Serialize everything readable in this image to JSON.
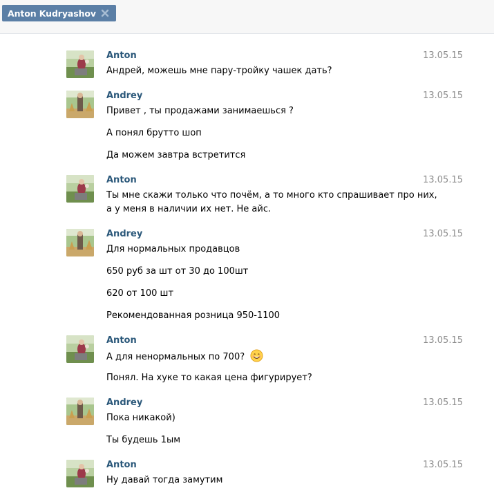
{
  "header": {
    "tab_name": "Anton Kudryashov",
    "close_icon": "close-icon"
  },
  "colors": {
    "tab_bg": "#5b7fa6",
    "author": "#2b587a",
    "date": "#8c8c8c"
  },
  "messages": [
    {
      "author": "Anton",
      "date": "13.05.15",
      "lines": [
        "Андрей, можешь мне пару-тройку чашек дать?"
      ]
    },
    {
      "author": "Andrey",
      "date": "13.05.15",
      "lines": [
        "Привет , ты продажами занимаешься ?",
        "А понял брутто шоп",
        "Да можем завтра встретится"
      ]
    },
    {
      "author": "Anton",
      "date": "13.05.15",
      "lines": [
        "Ты мне скажи только что почём, а то много кто спрашивает про них,",
        "а у меня в наличии их нет. Не айс."
      ]
    },
    {
      "author": "Andrey",
      "date": "13.05.15",
      "lines": [
        "Для нормальных продавцов",
        "650 руб за шт от 30 до 100шт",
        "620 от 100 шт",
        "Рекомендованная розница 950-1100"
      ]
    },
    {
      "author": "Anton",
      "date": "13.05.15",
      "lines": [
        "А для ненормальных по 700?",
        "Понял. На хуке то какая цена фигурирует?"
      ]
    },
    {
      "author": "Andrey",
      "date": "13.05.15",
      "lines": [
        "Пока никакой)",
        "Ты будешь 1ым"
      ]
    },
    {
      "author": "Anton",
      "date": "13.05.15",
      "lines": [
        "Ну давай тогда замутим"
      ]
    }
  ]
}
